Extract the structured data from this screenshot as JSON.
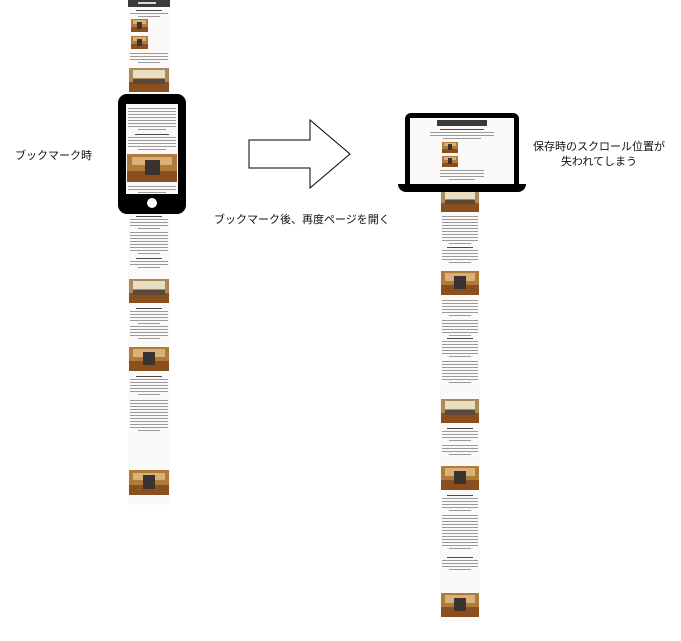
{
  "labels": {
    "bookmark_time": "ブックマーク時",
    "reopen_after_bookmark": "ブックマーク後、再度ページを開く",
    "scroll_lost_line1": "保存時のスクロール位置が",
    "scroll_lost_line2": "失われてしまう"
  },
  "icons": {
    "phone": "smartphone-icon",
    "laptop": "laptop-icon",
    "arrow": "right-arrow-icon"
  },
  "colors": {
    "device": "#000000",
    "page_header": "#3a3a3a",
    "photo_warm": "#b07a3a"
  }
}
